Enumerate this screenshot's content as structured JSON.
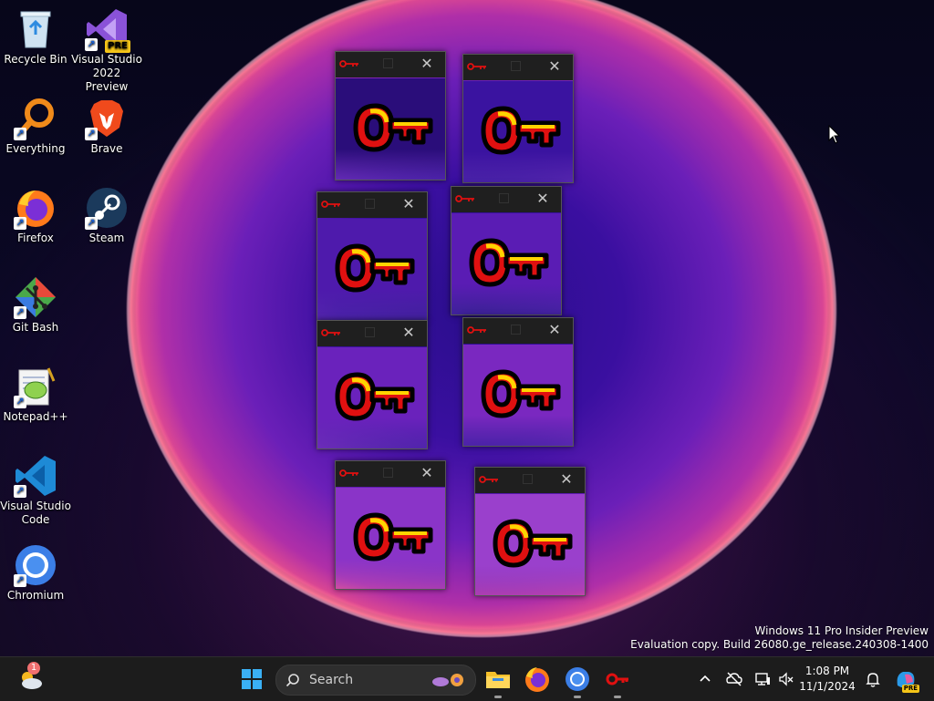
{
  "desktop": {
    "icons": [
      {
        "label": "Recycle Bin",
        "icon": "recycle-bin-icon"
      },
      {
        "label": "Visual Studio 2022 Preview",
        "icon": "visual-studio-preview-icon",
        "badge": "PRE"
      },
      {
        "label": "Everything",
        "icon": "everything-search-icon"
      },
      {
        "label": "Brave",
        "icon": "brave-browser-icon"
      },
      {
        "label": "Firefox",
        "icon": "firefox-icon"
      },
      {
        "label": "Steam",
        "icon": "steam-icon"
      },
      {
        "label": "Git Bash",
        "icon": "git-bash-icon"
      },
      {
        "label": "Notepad++",
        "icon": "notepad-plus-plus-icon"
      },
      {
        "label": "Visual Studio Code",
        "icon": "vscode-icon"
      },
      {
        "label": "Chromium",
        "icon": "chromium-icon"
      }
    ],
    "shortcut_arrow": "↗"
  },
  "key_windows": {
    "count": 8,
    "close_glyph": "✕",
    "icon": "key-icon",
    "body_gradient_colors": [
      "#2a0d7a",
      "#3a13a0",
      "#4e1aac",
      "#5a1cb4",
      "#6a22bc",
      "#7a28c0",
      "#8a34c8",
      "#9a40cc"
    ]
  },
  "watermark": {
    "line1": "Windows 11 Pro Insider Preview",
    "line2": "Evaluation copy. Build 26080.ge_release.240308-1400"
  },
  "taskbar": {
    "weather_icon": "weather-icon",
    "weather_badge": "1",
    "search_placeholder": "Search",
    "pinned": [
      "windows-start-icon",
      "file-explorer-icon",
      "firefox-icon",
      "chromium-icon",
      "key-app-icon"
    ],
    "clock_time": "1:08 PM",
    "clock_date": "11/1/2024",
    "tray": [
      "chevron-up-icon",
      "onedrive-offline-icon",
      "network-icon",
      "speaker-muted-icon",
      "notification-bell-icon",
      "copilot-icon"
    ],
    "copilot_badge": "PRE"
  },
  "colors": {
    "key_red": "#e01010",
    "key_yellow": "#ffd400",
    "taskbar_bg": "#1c1c1c"
  }
}
